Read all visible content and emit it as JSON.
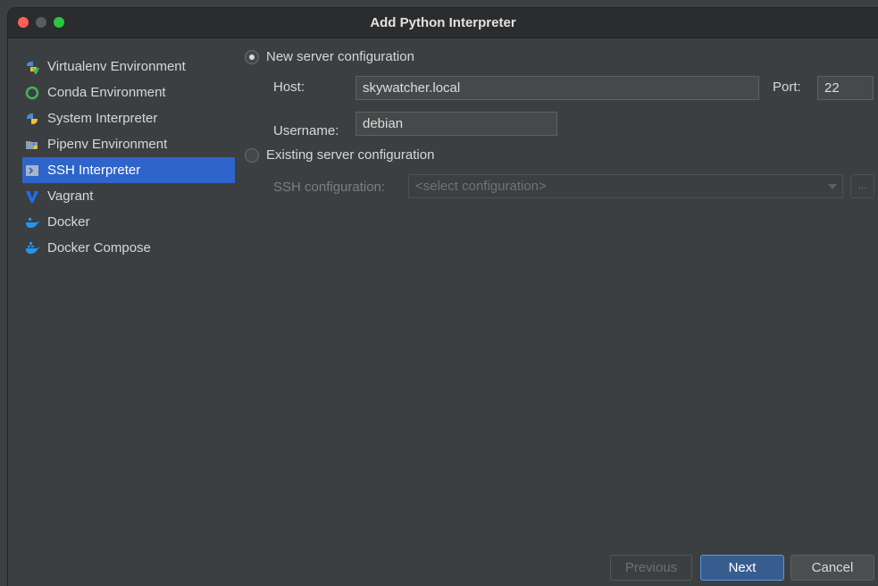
{
  "window": {
    "title": "Add Python Interpreter"
  },
  "sidebar": {
    "items": [
      {
        "label": "Virtualenv Environment",
        "icon": "virtualenv-icon"
      },
      {
        "label": "Conda Environment",
        "icon": "conda-icon"
      },
      {
        "label": "System Interpreter",
        "icon": "python-icon"
      },
      {
        "label": "Pipenv Environment",
        "icon": "pipenv-icon"
      },
      {
        "label": "SSH Interpreter",
        "icon": "ssh-icon",
        "selected": true
      },
      {
        "label": "Vagrant",
        "icon": "vagrant-icon"
      },
      {
        "label": "Docker",
        "icon": "docker-icon"
      },
      {
        "label": "Docker Compose",
        "icon": "docker-compose-icon"
      }
    ]
  },
  "main": {
    "new_config_label": "New server configuration",
    "host_label": "Host:",
    "host_value": "skywatcher.local",
    "port_label": "Port:",
    "port_value": "22",
    "username_label": "Username:",
    "username_value": "debian",
    "existing_config_label": "Existing server configuration",
    "ssh_config_label": "SSH configuration:",
    "ssh_config_placeholder": "<select configuration>",
    "browse_label": "..."
  },
  "footer": {
    "previous_label": "Previous",
    "next_label": "Next",
    "cancel_label": "Cancel"
  },
  "colors": {
    "selection": "#2f65ca",
    "background": "#3c3f41",
    "next_button": "#375d8f"
  }
}
